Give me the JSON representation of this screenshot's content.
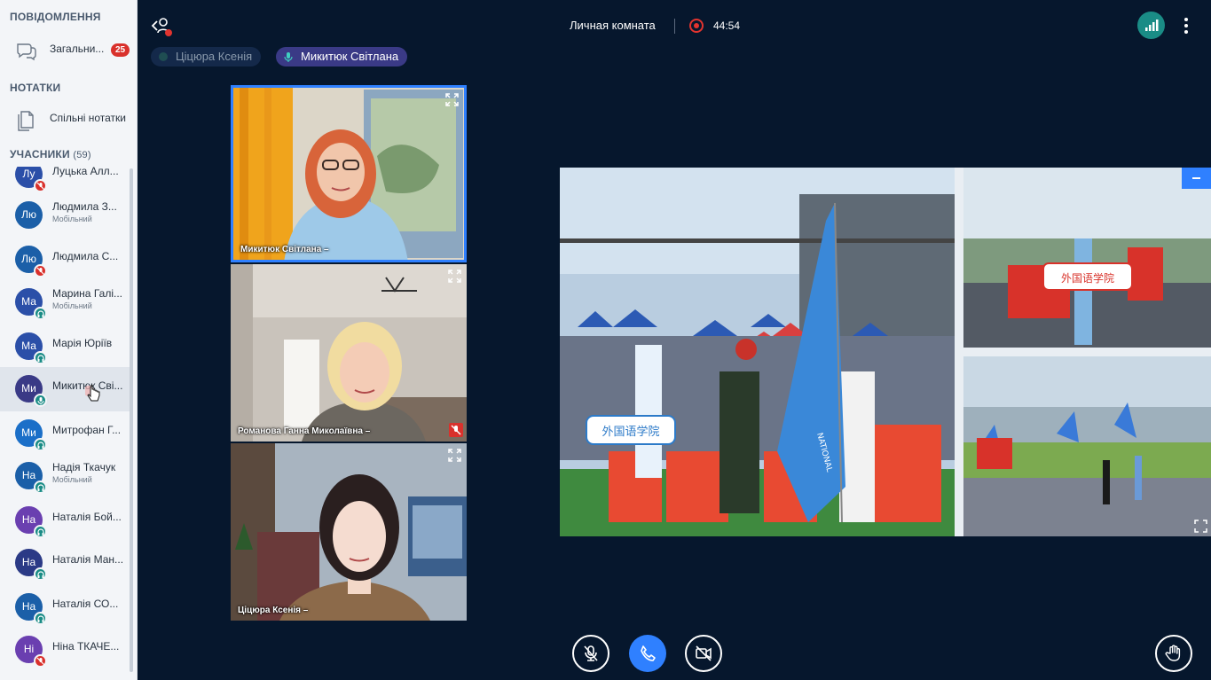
{
  "sidebar": {
    "messages_title": "ПОВІДОМЛЕННЯ",
    "general_chat_label": "Загальни...",
    "general_chat_badge": "25",
    "notes_title": "НОТАТКИ",
    "shared_notes_label": "Спільні нотатки",
    "participants_title": "УЧАСНИКИ",
    "participants_count": "(59)",
    "participants": [
      {
        "initials": "Лу",
        "name": "Луцька Алл...",
        "sub": "",
        "color": "#2b4fa8",
        "status": "muted"
      },
      {
        "initials": "Лю",
        "name": "Людмила З...",
        "sub": "Мобільний",
        "color": "#1b5fa8",
        "status": ""
      },
      {
        "initials": "Лю",
        "name": "Людмила С...",
        "sub": "",
        "color": "#1b5fa8",
        "status": "muted"
      },
      {
        "initials": "Ма",
        "name": "Марина Галі...",
        "sub": "Мобільний",
        "color": "#2b4fa8",
        "status": "listen"
      },
      {
        "initials": "Ма",
        "name": "Марія Юріїв",
        "sub": "",
        "color": "#2b4fa8",
        "status": "listen"
      },
      {
        "initials": "Ми",
        "name": "Микитюк Сві...",
        "sub": "",
        "color": "#3a3a86",
        "status": "mic"
      },
      {
        "initials": "Ми",
        "name": "Митрофан Г...",
        "sub": "",
        "color": "#1b6fc8",
        "status": "listen"
      },
      {
        "initials": "На",
        "name": "Надія Ткачук",
        "sub": "Мобільний",
        "color": "#1b5fa8",
        "status": "listen"
      },
      {
        "initials": "На",
        "name": "Наталія Бой...",
        "sub": "",
        "color": "#6a3fb0",
        "status": "listen"
      },
      {
        "initials": "На",
        "name": "Наталія Ман...",
        "sub": "",
        "color": "#2b3a86",
        "status": "listen"
      },
      {
        "initials": "На",
        "name": "Наталія СО...",
        "sub": "",
        "color": "#1b5fa8",
        "status": "listen"
      },
      {
        "initials": "Ні",
        "name": "Ніна ТКАЧЕ...",
        "sub": "",
        "color": "#6a3fb0",
        "status": "muted"
      }
    ]
  },
  "header": {
    "room_name": "Личная комната",
    "timer": "44:54"
  },
  "talking": [
    {
      "name": "Ціцюра Ксенія"
    },
    {
      "name": "Микитюк Світлана"
    }
  ],
  "videos": [
    {
      "name": "Микитюк Світлана –"
    },
    {
      "name": "Романова Ганна Миколаївна –"
    },
    {
      "name": "Ціцюра Ксенія –"
    }
  ],
  "share": {
    "sign_text": "外国语学院",
    "flag_text": "NATIONAL"
  },
  "colors": {
    "accent": "#2f80ff",
    "background": "#06172d",
    "recording": "#e2342f",
    "badge": "#d9312c"
  },
  "icons": [
    "chat-icon",
    "notes-icon",
    "leave-icon",
    "record-icon",
    "signal-icon",
    "more-icon",
    "expand-icon",
    "mic-off-icon",
    "phone-icon",
    "camera-off-icon",
    "raise-hand-icon"
  ]
}
